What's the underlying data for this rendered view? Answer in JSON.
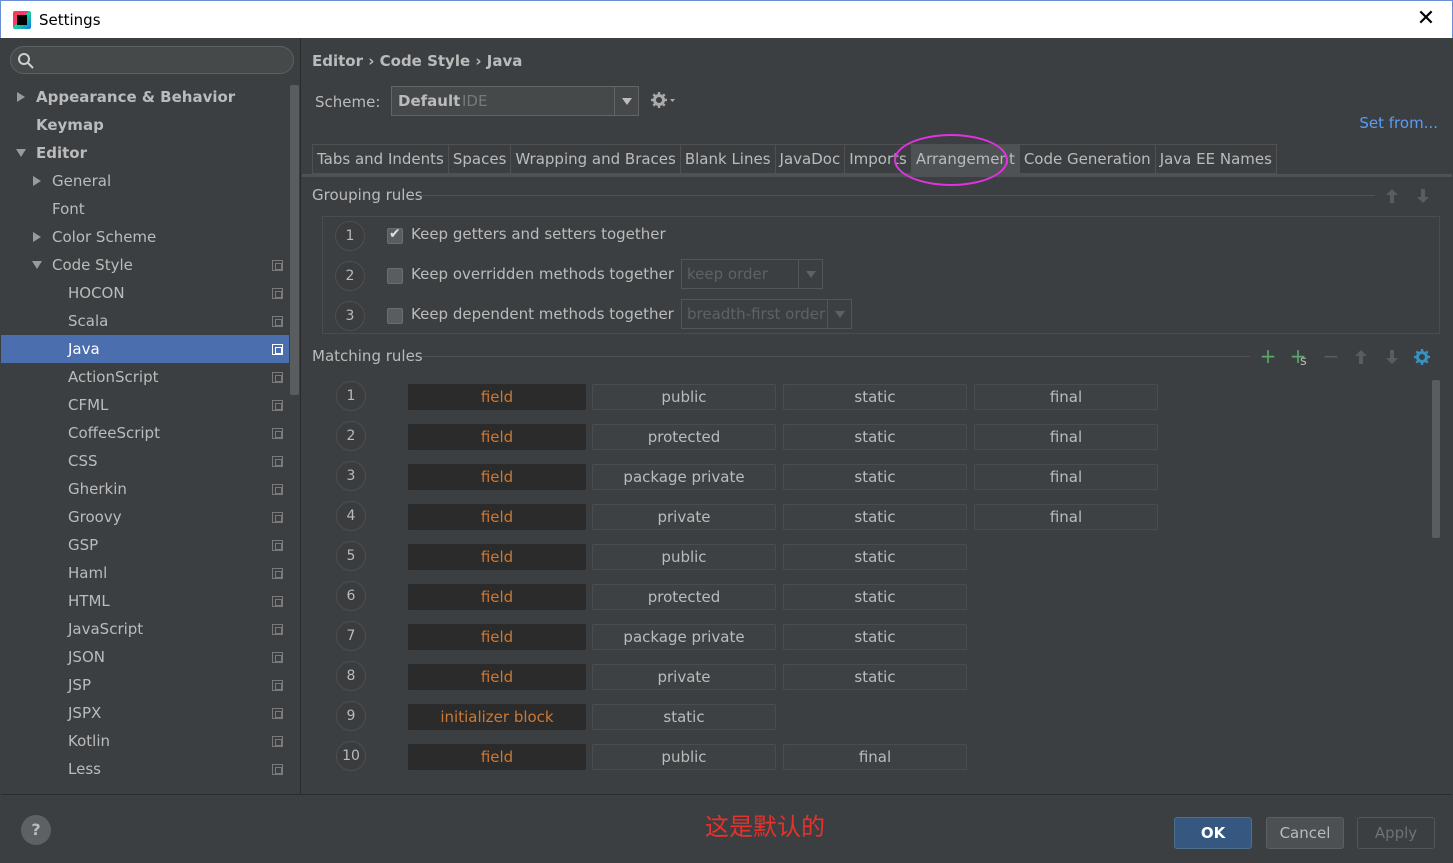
{
  "window": {
    "title": "Settings",
    "close_label": "✕"
  },
  "sidebar": {
    "search_placeholder": "",
    "items": [
      {
        "label": "Appearance & Behavior",
        "arrow": "right",
        "bold": true,
        "level": 0,
        "copy": false
      },
      {
        "label": "Keymap",
        "arrow": "none",
        "bold": true,
        "level": 0,
        "copy": false
      },
      {
        "label": "Editor",
        "arrow": "down",
        "bold": true,
        "level": 0,
        "copy": false
      },
      {
        "label": "General",
        "arrow": "right",
        "bold": false,
        "level": 1,
        "copy": false
      },
      {
        "label": "Font",
        "arrow": "none",
        "bold": false,
        "level": 1,
        "copy": false
      },
      {
        "label": "Color Scheme",
        "arrow": "right",
        "bold": false,
        "level": 1,
        "copy": false
      },
      {
        "label": "Code Style",
        "arrow": "down",
        "bold": false,
        "level": 1,
        "copy": true
      },
      {
        "label": "HOCON",
        "arrow": "none",
        "bold": false,
        "level": 2,
        "copy": true
      },
      {
        "label": "Scala",
        "arrow": "none",
        "bold": false,
        "level": 2,
        "copy": true
      },
      {
        "label": "Java",
        "arrow": "none",
        "bold": false,
        "level": 2,
        "copy": true,
        "selected": true
      },
      {
        "label": "ActionScript",
        "arrow": "none",
        "bold": false,
        "level": 2,
        "copy": true
      },
      {
        "label": "CFML",
        "arrow": "none",
        "bold": false,
        "level": 2,
        "copy": true
      },
      {
        "label": "CoffeeScript",
        "arrow": "none",
        "bold": false,
        "level": 2,
        "copy": true
      },
      {
        "label": "CSS",
        "arrow": "none",
        "bold": false,
        "level": 2,
        "copy": true
      },
      {
        "label": "Gherkin",
        "arrow": "none",
        "bold": false,
        "level": 2,
        "copy": true
      },
      {
        "label": "Groovy",
        "arrow": "none",
        "bold": false,
        "level": 2,
        "copy": true
      },
      {
        "label": "GSP",
        "arrow": "none",
        "bold": false,
        "level": 2,
        "copy": true
      },
      {
        "label": "Haml",
        "arrow": "none",
        "bold": false,
        "level": 2,
        "copy": true
      },
      {
        "label": "HTML",
        "arrow": "none",
        "bold": false,
        "level": 2,
        "copy": true
      },
      {
        "label": "JavaScript",
        "arrow": "none",
        "bold": false,
        "level": 2,
        "copy": true
      },
      {
        "label": "JSON",
        "arrow": "none",
        "bold": false,
        "level": 2,
        "copy": true
      },
      {
        "label": "JSP",
        "arrow": "none",
        "bold": false,
        "level": 2,
        "copy": true
      },
      {
        "label": "JSPX",
        "arrow": "none",
        "bold": false,
        "level": 2,
        "copy": true
      },
      {
        "label": "Kotlin",
        "arrow": "none",
        "bold": false,
        "level": 2,
        "copy": true
      },
      {
        "label": "Less",
        "arrow": "none",
        "bold": false,
        "level": 2,
        "copy": true
      }
    ]
  },
  "header": {
    "breadcrumb": "Editor › Code Style › Java",
    "scheme_label": "Scheme:",
    "scheme_value": "Default",
    "scheme_suffix": "IDE",
    "set_from": "Set from..."
  },
  "tabs": [
    {
      "label": "Tabs and Indents"
    },
    {
      "label": "Spaces"
    },
    {
      "label": "Wrapping and Braces"
    },
    {
      "label": "Blank Lines"
    },
    {
      "label": "JavaDoc"
    },
    {
      "label": "Imports"
    },
    {
      "label": "Arrangement",
      "active": true
    },
    {
      "label": "Code Generation"
    },
    {
      "label": "Java EE Names"
    }
  ],
  "grouping": {
    "title": "Grouping rules",
    "rows": [
      {
        "num": "1",
        "label": "Keep getters and setters together",
        "checked": true,
        "select": ""
      },
      {
        "num": "2",
        "label": "Keep overridden methods together",
        "checked": false,
        "select": "keep order"
      },
      {
        "num": "3",
        "label": "Keep dependent methods together",
        "checked": false,
        "select": "breadth-first order"
      }
    ]
  },
  "matching": {
    "title": "Matching rules",
    "rows": [
      {
        "num": "1",
        "kind": "field",
        "tokens": [
          "public",
          "static",
          "final"
        ]
      },
      {
        "num": "2",
        "kind": "field",
        "tokens": [
          "protected",
          "static",
          "final"
        ]
      },
      {
        "num": "3",
        "kind": "field",
        "tokens": [
          "package private",
          "static",
          "final"
        ]
      },
      {
        "num": "4",
        "kind": "field",
        "tokens": [
          "private",
          "static",
          "final"
        ]
      },
      {
        "num": "5",
        "kind": "field",
        "tokens": [
          "public",
          "static"
        ]
      },
      {
        "num": "6",
        "kind": "field",
        "tokens": [
          "protected",
          "static"
        ]
      },
      {
        "num": "7",
        "kind": "field",
        "tokens": [
          "package private",
          "static"
        ]
      },
      {
        "num": "8",
        "kind": "field",
        "tokens": [
          "private",
          "static"
        ]
      },
      {
        "num": "9",
        "kind": "initializer block",
        "tokens": [
          "static"
        ]
      },
      {
        "num": "10",
        "kind": "field",
        "tokens": [
          "public",
          "final"
        ]
      }
    ]
  },
  "footer": {
    "help": "?",
    "note": "这是默认的",
    "ok": "OK",
    "cancel": "Cancel",
    "apply": "Apply"
  },
  "colors": {
    "background": "#3c3f41",
    "selection": "#4b6eaf",
    "keyword_orange": "#cc7832",
    "link_blue": "#589df6",
    "annotation_magenta": "#e032e0",
    "note_red": "#e8312a",
    "add_green": "#59a869"
  }
}
